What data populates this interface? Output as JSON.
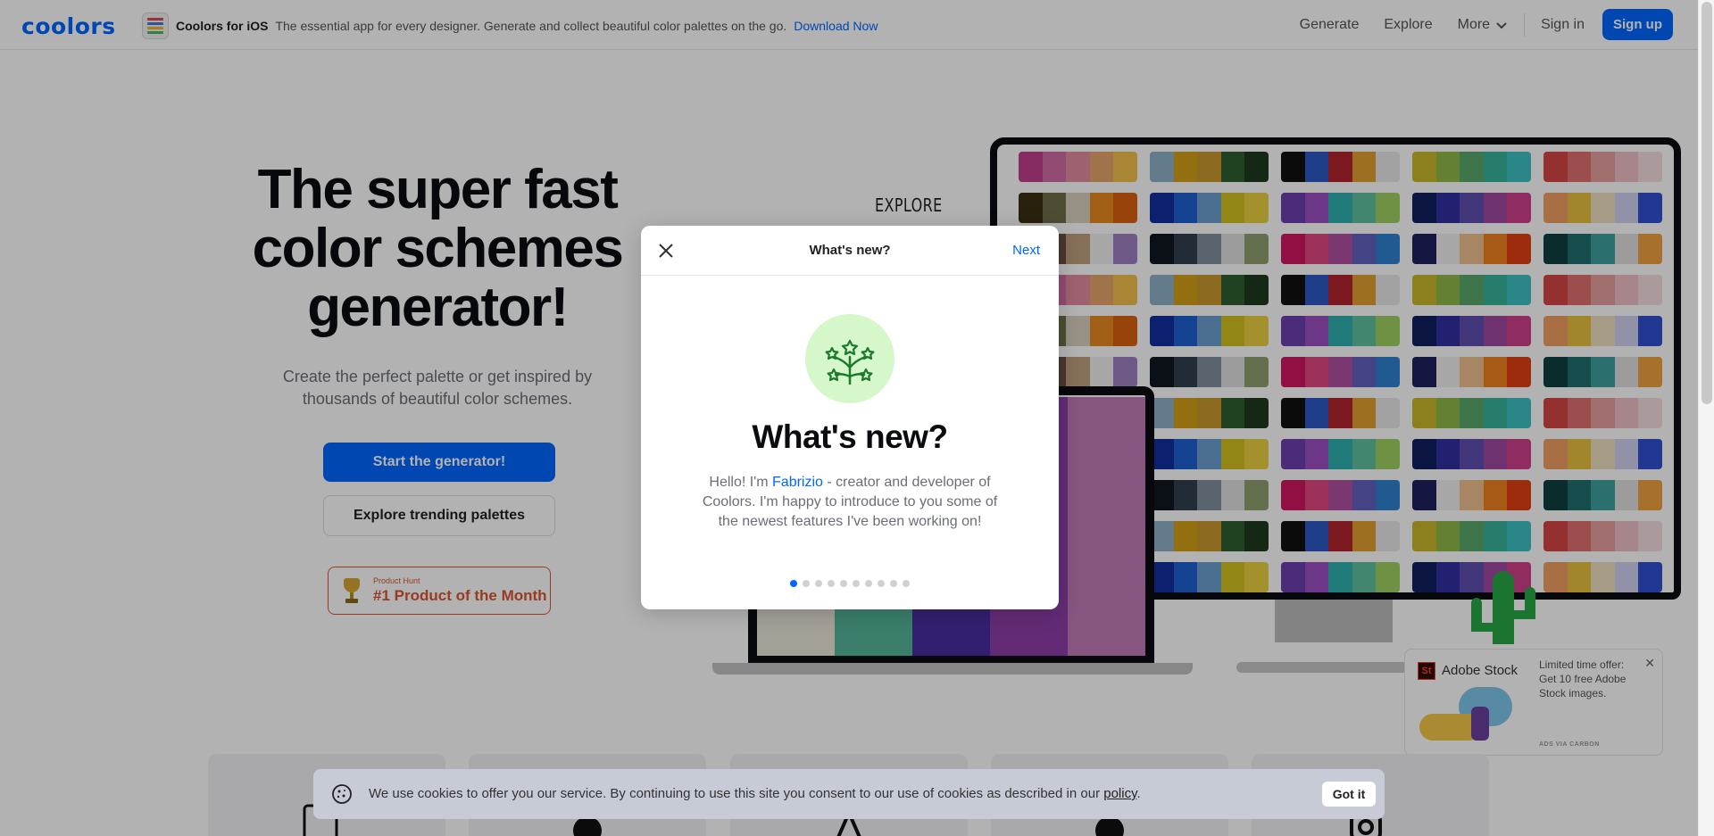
{
  "nav": {
    "logo": "coolors",
    "promo_title": "Coolors for iOS",
    "promo_text": "The essential app for every designer. Generate and collect beautiful color palettes on the go.",
    "promo_link": "Download Now",
    "generate": "Generate",
    "explore": "Explore",
    "more": "More",
    "sign_in": "Sign in",
    "sign_up": "Sign up"
  },
  "hero": {
    "title_line1": "The super fast",
    "title_line2": "color schemes",
    "title_line3": "generator!",
    "subtitle": "Create the perfect palette or get inspired by thousands of beautiful color schemes.",
    "start_button": "Start the generator!",
    "explore_button": "Explore trending palettes",
    "ph_small": "Product Hunt",
    "ph_big": "#1 Product of the Month"
  },
  "illustration": {
    "explore_label": "EXPLORE"
  },
  "modal": {
    "header_title": "What's new?",
    "next": "Next",
    "heading": "What's new?",
    "body_before": "Hello! I'm ",
    "body_name": "Fabrizio",
    "body_after": " - creator and developer of Coolors. I'm happy to introduce to you some of the newest features I've been working on!",
    "page_count": 10,
    "active_page": 1
  },
  "ad": {
    "brand": "Adobe Stock",
    "text": "Limited time offer: Get 10 free Adobe Stock images.",
    "via": "ADS VIA CARBON"
  },
  "cookie": {
    "text_before": "We use cookies to offer you our service. By continuing to use this site you consent to our use of cookies as described in our ",
    "link": "policy",
    "text_after": ".",
    "button": "Got it"
  },
  "colors": {
    "brand_blue": "#0066ff",
    "product_hunt": "#da552f"
  }
}
